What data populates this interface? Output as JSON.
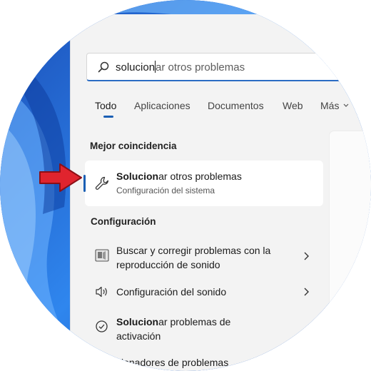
{
  "search": {
    "typed": "solucion",
    "completion": "ar otros problemas"
  },
  "tabs": [
    {
      "label": "Todo",
      "active": true
    },
    {
      "label": "Aplicaciones"
    },
    {
      "label": "Documentos"
    },
    {
      "label": "Web"
    },
    {
      "label": "Más"
    }
  ],
  "best_match": {
    "section_title": "Mejor coincidencia",
    "title_bold": "Solucion",
    "title_rest": "ar otros problemas",
    "subtitle": "Configuración del sistema",
    "icon": "wrench-icon"
  },
  "settings": {
    "section_title": "Configuración",
    "items": [
      {
        "line1": "Buscar y corregir problemas con la",
        "line2": "reproducción de sonido",
        "icon": "audio-troubleshoot-icon"
      },
      {
        "line1": "Configuración del sonido",
        "icon": "speaker-icon"
      },
      {
        "bold": "Solucion",
        "rest": "ar problemas de",
        "line2": "activación",
        "icon": "check-circle-icon"
      },
      {
        "partial": "cionadores de problemas"
      }
    ]
  },
  "colors": {
    "accent": "#1a5fb4",
    "arrow": "#e0242e",
    "wallpaper": "#1f66d8"
  }
}
